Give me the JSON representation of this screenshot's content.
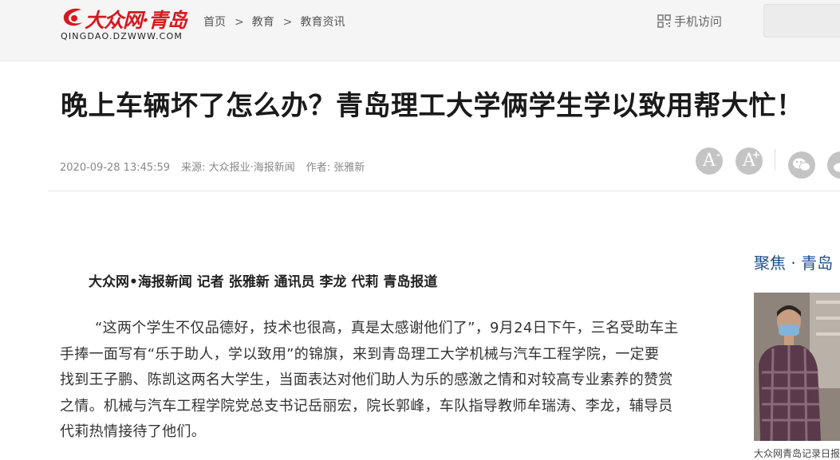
{
  "header": {
    "logo_text": "大众网·青岛",
    "logo_sub": "QINGDAO.DZWWW.COM",
    "breadcrumb": [
      "首页",
      "教育",
      "教育资讯"
    ],
    "breadcrumb_sep": ">",
    "mobile_label": "手机访问",
    "brand_color": "#d7181f"
  },
  "article": {
    "title": "晚上车辆坏了怎么办？青岛理工大学俩学生学以致用帮大忙！",
    "date": "2020-09-28 13:45:59",
    "source": "来源: 大众报业·海报新闻",
    "author": "作者: 张雅新",
    "byline": "大众网•海报新闻 记者 张雅新 通讯员 李龙 代莉 青岛报道",
    "para1_lines": [
      "“这两个学生不仅品德好，技术也很高，真是太感谢他们了”，9月24日下午，三名受助车主",
      "手捧一面写有“乐于助人，学以致用”的锦旗，来到青岛理工大学机械与汽车工程学院，一定要",
      "找到王子鹏、陈凯这两名大学生，当面表达对他们助人为乐的感激之情和对较高专业素养的赞赏",
      "之情。机械与汽车工程学院党总支书记岳丽宏，院长郭峰，车队指导教师牟瑞涛、李龙，辅导员",
      "代莉热情接待了他们。"
    ]
  },
  "tools": {
    "font_decrease": {
      "glyph": "A",
      "mark": "-"
    },
    "font_increase": {
      "glyph": "A",
      "mark": "+"
    }
  },
  "sidebar": {
    "title": "聚焦 · 青岛",
    "caption": "大众网青岛记录日报"
  }
}
